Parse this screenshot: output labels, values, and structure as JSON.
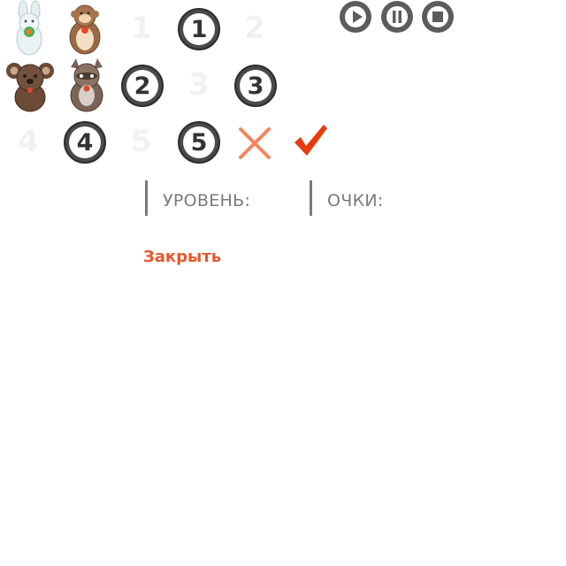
{
  "toys": [
    {
      "kind": "bunny",
      "icon": "bunny-toy-icon"
    },
    {
      "kind": "monkey",
      "icon": "monkey-toy-icon"
    },
    {
      "kind": "koala",
      "icon": "koala-toy-icon"
    },
    {
      "kind": "raccoon",
      "icon": "raccoon-toy-icon"
    }
  ],
  "numbers": {
    "n1": "1",
    "n2": "2",
    "n3": "3",
    "n4": "4",
    "n5": "5"
  },
  "controls": {
    "play_icon": "play-icon",
    "pause_icon": "pause-icon",
    "stop_icon": "stop-icon",
    "control_color": "#5c5c5c"
  },
  "marks": {
    "wrong_icon": "cross-icon",
    "right_icon": "check-icon",
    "wrong_color": "#f2855f",
    "right_color": "#e83a0e"
  },
  "hud": {
    "level_label": "УРОВЕНЬ:",
    "score_label": "ОЧКИ:"
  },
  "close_label": "Закрыть",
  "accent_color": "#e8562a"
}
